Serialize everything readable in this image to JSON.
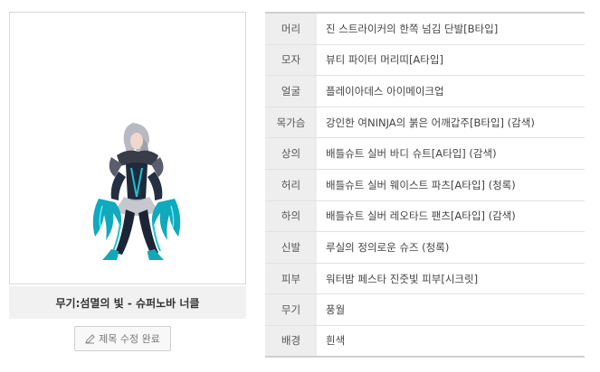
{
  "character": {
    "caption": "무기:섬멸의 빛 - 슈퍼노바 너클"
  },
  "edit_button": {
    "label": "제목 수정 완료",
    "icon": "pencil-icon"
  },
  "equipment": [
    {
      "slot": "머리",
      "item": "진 스트라이커의 한쪽 넘김 단발[B타입]"
    },
    {
      "slot": "모자",
      "item": "뷰티 파이터 머리띠[A타입]"
    },
    {
      "slot": "얼굴",
      "item": "플레이아데스 아이메이크업"
    },
    {
      "slot": "목가슴",
      "item": "강인한 여NINJA의 붉은 어깨갑주[B타입] (감색)"
    },
    {
      "slot": "상의",
      "item": "배틀슈트 실버 바디 슈트[A타입] (감색)"
    },
    {
      "slot": "허리",
      "item": "배틀슈트 실버 웨이스트 파츠[A타입] (청록)"
    },
    {
      "slot": "하의",
      "item": "배틀슈트 실버 레오타드 팬츠[A타입] (감색)"
    },
    {
      "slot": "신발",
      "item": "루실의 정의로운 슈즈 (청록)"
    },
    {
      "slot": "피부",
      "item": "워터밤 페스타 진줏빛 피부[시크릿]"
    },
    {
      "slot": "무기",
      "item": "풍월"
    },
    {
      "slot": "배경",
      "item": "흰색"
    }
  ]
}
